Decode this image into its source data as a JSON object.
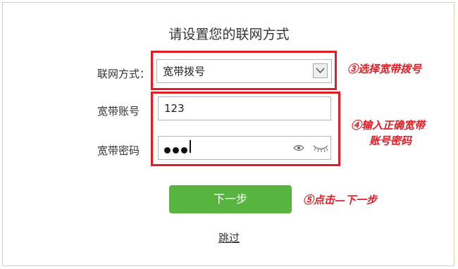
{
  "page": {
    "title": "请设置您的联网方式"
  },
  "form": {
    "connection_type": {
      "label": "联网方式：",
      "value": "宽带拨号"
    },
    "account": {
      "label": "宽带账号",
      "value": "123"
    },
    "password": {
      "label": "宽带密码",
      "masked_length": 3
    }
  },
  "buttons": {
    "next_label": "下一步",
    "skip_label": "跳过"
  },
  "annotations": {
    "step3": "③选择宽带拨号",
    "step4_line1": "④输入正确宽带",
    "step4_line2": "账号密码",
    "step5": "⑤点击—下一步"
  },
  "colors": {
    "highlight": "#e01d24",
    "primary_button": "#57b43e"
  },
  "icons": {
    "select": "chevron-down-icon",
    "show_password": "eye-icon",
    "hide_password": "eye-closed-icon"
  }
}
